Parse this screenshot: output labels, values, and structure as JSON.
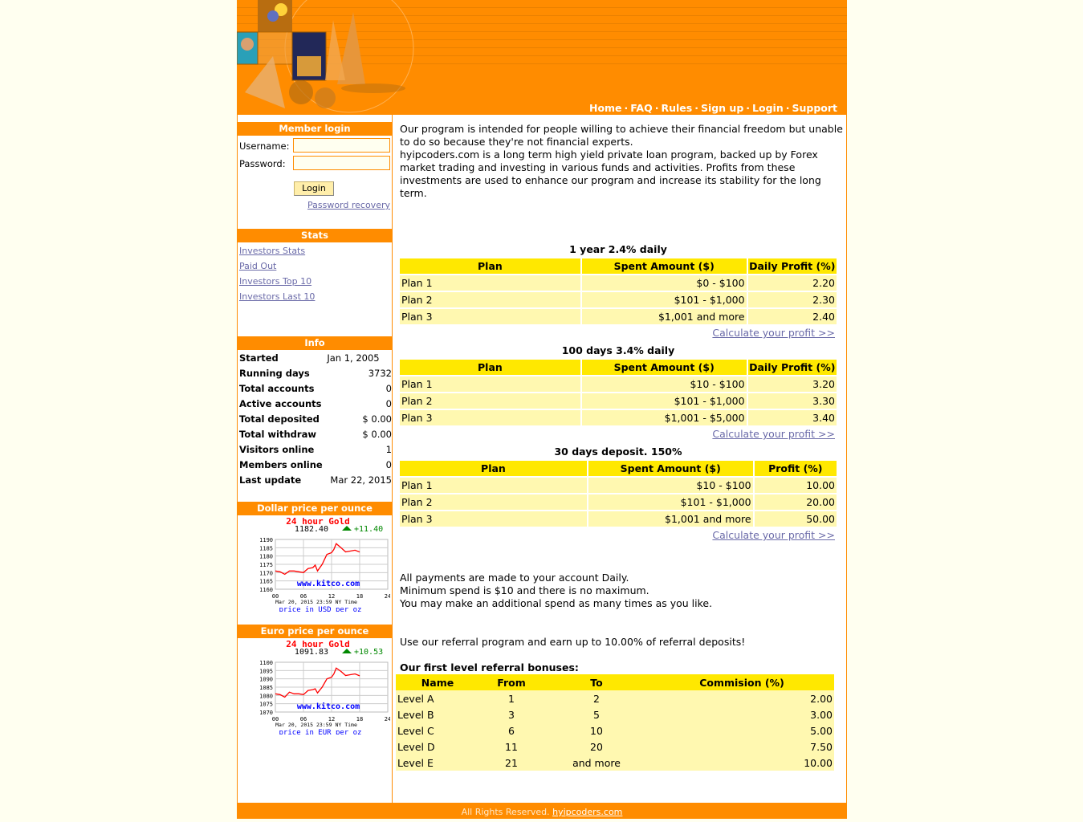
{
  "nav": [
    "Home",
    "FAQ",
    "Rules",
    "Sign up",
    "Login",
    "Support"
  ],
  "login": {
    "title": "Member login",
    "username_label": "Username:",
    "password_label": "Password:",
    "username_value": "",
    "password_value": "",
    "button": "Login",
    "recovery": "Password recovery"
  },
  "stats": {
    "title": "Stats",
    "links": [
      "Investors Stats",
      "Paid Out",
      "Investors Top 10",
      "Investors Last 10"
    ]
  },
  "info": {
    "title": "Info",
    "rows": [
      {
        "k": "Started",
        "v": "Jan 1, 2005"
      },
      {
        "k": "Running days",
        "v": "3732"
      },
      {
        "k": "Total accounts",
        "v": "0"
      },
      {
        "k": "Active accounts",
        "v": "0"
      },
      {
        "k": "Total deposited",
        "v": "$ 0.00"
      },
      {
        "k": "Total withdraw",
        "v": "$ 0.00"
      },
      {
        "k": "Visitors online",
        "v": "1"
      },
      {
        "k": "Members online",
        "v": "0"
      },
      {
        "k": "Last update",
        "v": "Mar 22, 2015"
      }
    ]
  },
  "gold": [
    {
      "title": "Dollar price per ounce",
      "heading": "24 hour Gold",
      "price": "1182.40",
      "change": "+11.40",
      "site": "www.kitco.com",
      "time": "Mar 20, 2015 23:59 NY Time",
      "unit": "price in USD per oz",
      "yticks": [
        "1190",
        "1185",
        "1180",
        "1175",
        "1170",
        "1165",
        "1160"
      ],
      "ymin": 1160,
      "ymax": 1190,
      "points": [
        [
          0,
          1171
        ],
        [
          1,
          1170.5
        ],
        [
          2,
          1169
        ],
        [
          3,
          1171
        ],
        [
          4,
          1171
        ],
        [
          5,
          1170.5
        ],
        [
          6,
          1170
        ],
        [
          7,
          1172.5
        ],
        [
          8,
          1173
        ],
        [
          8.5,
          1174.5
        ],
        [
          9,
          1171
        ],
        [
          10,
          1175
        ],
        [
          11,
          1181
        ],
        [
          12,
          1182
        ],
        [
          12.5,
          1184
        ],
        [
          13,
          1187.5
        ],
        [
          14,
          1185
        ],
        [
          15,
          1182.5
        ],
        [
          16,
          1183
        ],
        [
          17,
          1183.5
        ],
        [
          18,
          1182.4
        ]
      ]
    },
    {
      "title": "Euro price per ounce",
      "heading": "24 hour Gold",
      "price": "1091.83",
      "change": "+10.53",
      "site": "www.kitco.com",
      "time": "Mar 20, 2015 23:59 NY Time",
      "unit": "price in EUR per oz",
      "yticks": [
        "1100",
        "1095",
        "1090",
        "1085",
        "1080",
        "1075",
        "1070"
      ],
      "ymin": 1070,
      "ymax": 1100,
      "points": [
        [
          0,
          1081
        ],
        [
          1,
          1080.5
        ],
        [
          2,
          1079
        ],
        [
          3,
          1082
        ],
        [
          4,
          1081
        ],
        [
          5,
          1081
        ],
        [
          6,
          1080.5
        ],
        [
          7,
          1083
        ],
        [
          8,
          1083.5
        ],
        [
          8.5,
          1084
        ],
        [
          9,
          1081.5
        ],
        [
          10,
          1085
        ],
        [
          11,
          1090
        ],
        [
          12,
          1091
        ],
        [
          12.5,
          1093
        ],
        [
          13,
          1096.5
        ],
        [
          14,
          1094.5
        ],
        [
          15,
          1092
        ],
        [
          16,
          1092.5
        ],
        [
          17,
          1093
        ],
        [
          18,
          1091.83
        ]
      ]
    }
  ],
  "gold_xticks": [
    "00",
    "06",
    "12",
    "18",
    "24"
  ],
  "intro": [
    "Our program is intended for people willing to achieve their financial freedom but unable to do so because they're not financial experts.",
    "hyipcoders.com is a long term high yield private loan program, backed up by Forex market trading and investing in various funds and activities. Profits from these investments are used to enhance our program and increase its stability for the long term."
  ],
  "plans": [
    {
      "title": "1 year 2.4% daily",
      "headers": [
        "Plan",
        "Spent Amount ($)",
        "Daily Profit (%)"
      ],
      "rows": [
        [
          "Plan 1",
          "$0 - $100",
          "2.20"
        ],
        [
          "Plan 2",
          "$101 - $1,000",
          "2.30"
        ],
        [
          "Plan 3",
          "$1,001 and more",
          "2.40"
        ]
      ],
      "calc": "Calculate your profit >>"
    },
    {
      "title": "100 days 3.4% daily",
      "headers": [
        "Plan",
        "Spent Amount ($)",
        "Daily Profit (%)"
      ],
      "rows": [
        [
          "Plan 1",
          "$10 - $100",
          "3.20"
        ],
        [
          "Plan 2",
          "$101 - $1,000",
          "3.30"
        ],
        [
          "Plan 3",
          "$1,001 - $5,000",
          "3.40"
        ]
      ],
      "calc": "Calculate your profit >>"
    },
    {
      "title": "30 days deposit. 150%",
      "headers": [
        "Plan",
        "Spent Amount ($)",
        "Profit (%)"
      ],
      "rows": [
        [
          "Plan 1",
          "$10 - $100",
          "10.00"
        ],
        [
          "Plan 2",
          "$101 - $1,000",
          "20.00"
        ],
        [
          "Plan 3",
          "$1,001 and more",
          "50.00"
        ]
      ],
      "calc": "Calculate your profit >>"
    }
  ],
  "payments": [
    "All payments are made to your account Daily.",
    "Minimum spend is $10 and there is no maximum.",
    "You may make an additional spend as many times as you like."
  ],
  "referral_text": "Use our referral program and earn up to 10.00% of referral deposits!",
  "referral": {
    "title": "Our first level referral bonuses:",
    "headers": [
      "Name",
      "From",
      "To",
      "Commision (%)"
    ],
    "rows": [
      [
        "Level A",
        "1",
        "2",
        "2.00"
      ],
      [
        "Level B",
        "3",
        "5",
        "3.00"
      ],
      [
        "Level C",
        "6",
        "10",
        "5.00"
      ],
      [
        "Level D",
        "11",
        "20",
        "7.50"
      ],
      [
        "Level E",
        "21",
        "and more",
        "10.00"
      ]
    ]
  },
  "footer": {
    "text": "All Rights Reserved.",
    "link": "hyipcoders.com"
  }
}
